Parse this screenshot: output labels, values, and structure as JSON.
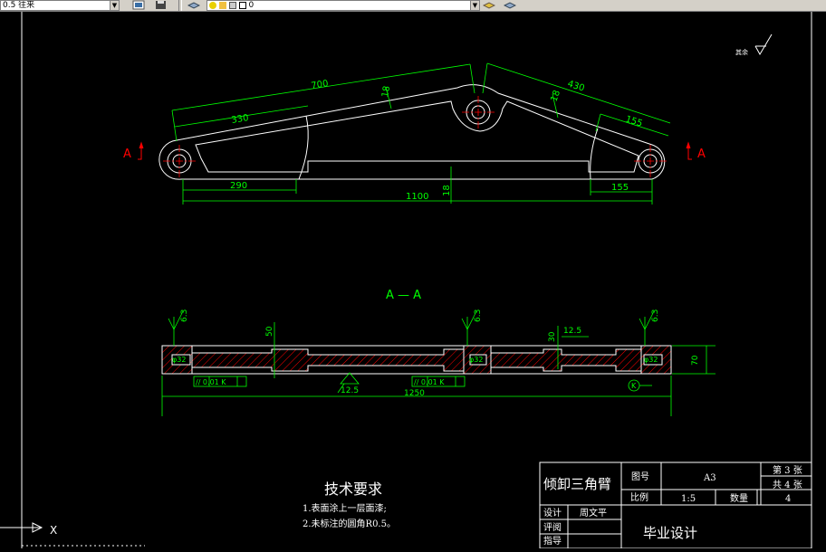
{
  "toolbar": {
    "layer_combo": "0.5 往来",
    "layer_combo2": "0",
    "colors": {
      "bg": "#d4d0c8",
      "field": "#ffffff"
    }
  },
  "drawing": {
    "surface_mark": "其余",
    "dims_top": {
      "d700": "700",
      "d330": "330",
      "d430": "430",
      "d155r": "155",
      "d18a": "18",
      "d18b": "18",
      "d290": "290",
      "d155b": "155",
      "d1100": "1100",
      "d18c": "18"
    },
    "section_label_left": "A",
    "section_label_right": "A",
    "section_title": "A — A",
    "dims_section": {
      "r63a": "6.3",
      "r63b": "6.3",
      "r63c": "6.3",
      "d50": "50",
      "d30": "30",
      "d125top": "12.5",
      "phi32a": "φ32",
      "phi32b": "φ32",
      "phi32c": "φ32",
      "d70": "70",
      "tol1": "// 0.01 K",
      "tol2": "// 0.01 K",
      "r125": "12.5",
      "d1250": "1250",
      "datum": "K"
    },
    "ucs_x": "X",
    "colors": {
      "bg": "#000000",
      "green": "#00ff00",
      "white": "#ffffff",
      "red": "#ff0000",
      "hatch": "#ff0000"
    }
  },
  "tech": {
    "title": "技术要求",
    "line1": "1.表面涂上一层面漆;",
    "line2": "2.未标注的圆角R0.5。"
  },
  "title_block": {
    "part_name": "倾卸三角臂",
    "drawing_no_label": "图号",
    "drawing_no": "A3",
    "sheet_label": "第 3 张",
    "total_label": "共 4 张",
    "scale_label": "比例",
    "scale": "1:5",
    "qty_label": "数量",
    "qty": "4",
    "design_label": "设计",
    "designer": "周文平",
    "review_label": "评阅",
    "guide_label": "指导",
    "project": "毕业设计"
  }
}
